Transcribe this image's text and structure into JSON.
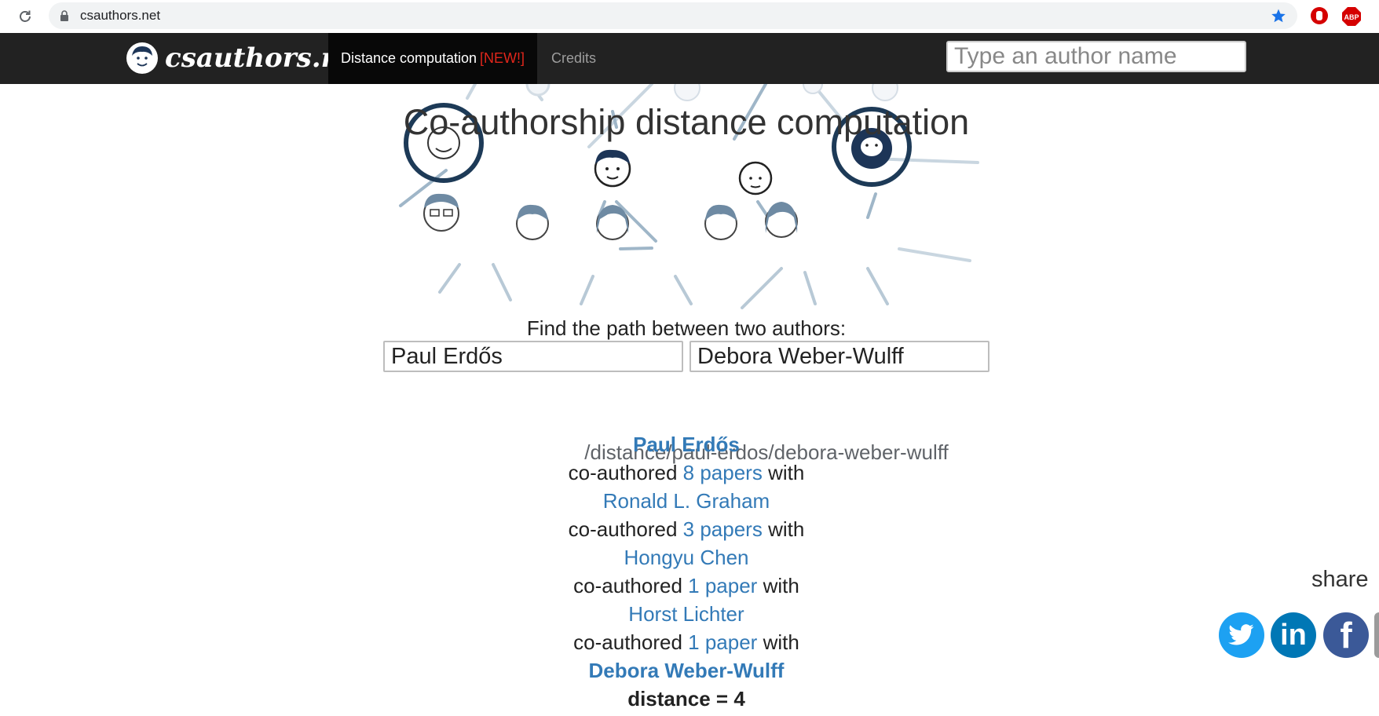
{
  "browser": {
    "url_host": "csauthors.net",
    "url_path": "/distance/paul-erdos/debora-weber-wulff",
    "icons": [
      "reload-icon",
      "lock-icon",
      "star-icon",
      "ublock-icon",
      "abp-icon"
    ],
    "abp_label": "ABP"
  },
  "navbar": {
    "logo_text": "csauthors.net",
    "active_item": "Distance computation",
    "active_badge": "[NEW!]",
    "credits": "Credits",
    "search_placeholder": "Type an author name"
  },
  "main": {
    "title": "Co-authorship distance computation",
    "find_label": "Find the path between two authors:",
    "author_a": "Paul Erdős",
    "author_b": "Debora Weber-Wulff"
  },
  "path": {
    "start": "Paul Erdős",
    "steps": [
      {
        "prefix": "co-authored",
        "count": "8 papers",
        "suffix": "with",
        "author": "Ronald L. Graham"
      },
      {
        "prefix": "co-authored",
        "count": "3 papers",
        "suffix": "with",
        "author": "Hongyu Chen"
      },
      {
        "prefix": "co-authored",
        "count": "1 paper",
        "suffix": "with",
        "author": "Horst Lichter"
      },
      {
        "prefix": "co-authored",
        "count": "1 paper",
        "suffix": "with",
        "author": "Debora Weber-Wulff"
      }
    ],
    "distance": "distance = 4"
  },
  "share": {
    "label": "share",
    "icons": [
      "twitter-icon",
      "linkedin-icon",
      "facebook-icon"
    ],
    "linkedin_glyph": "in",
    "facebook_glyph": "f"
  },
  "colors": {
    "link": "#337ab7",
    "navbar": "#222222",
    "badge": "#e0261b",
    "twitter": "#1da1f2",
    "linkedin": "#0077b5",
    "facebook": "#3b5998"
  }
}
